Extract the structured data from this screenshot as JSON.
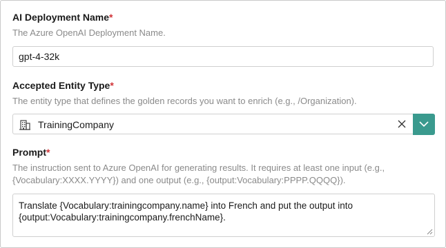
{
  "deployment": {
    "label": "AI Deployment Name",
    "required_mark": "*",
    "help": "The Azure OpenAI Deployment Name.",
    "value": "gpt-4-32k"
  },
  "entity_type": {
    "label": "Accepted Entity Type",
    "required_mark": "*",
    "help": "The entity type that defines the golden records you want to enrich (e.g., /Organization).",
    "value": "TrainingCompany",
    "icon": "building-icon"
  },
  "prompt": {
    "label": "Prompt",
    "required_mark": "*",
    "help": "The instruction sent to Azure OpenAI for generating results. It requires at least one input (e.g., {Vocabulary:XXXX.YYYY}) and one output (e.g., {output:Vocabulary:PPPP.QQQQ}).",
    "value": "Translate {Vocabulary:trainingcompany.name} into French and put the output into {output:Vocabulary:trainingcompany.frenchName}."
  },
  "colors": {
    "accent": "#3a9a8e",
    "required": "#d13438",
    "help_text": "#8a8a8a"
  }
}
